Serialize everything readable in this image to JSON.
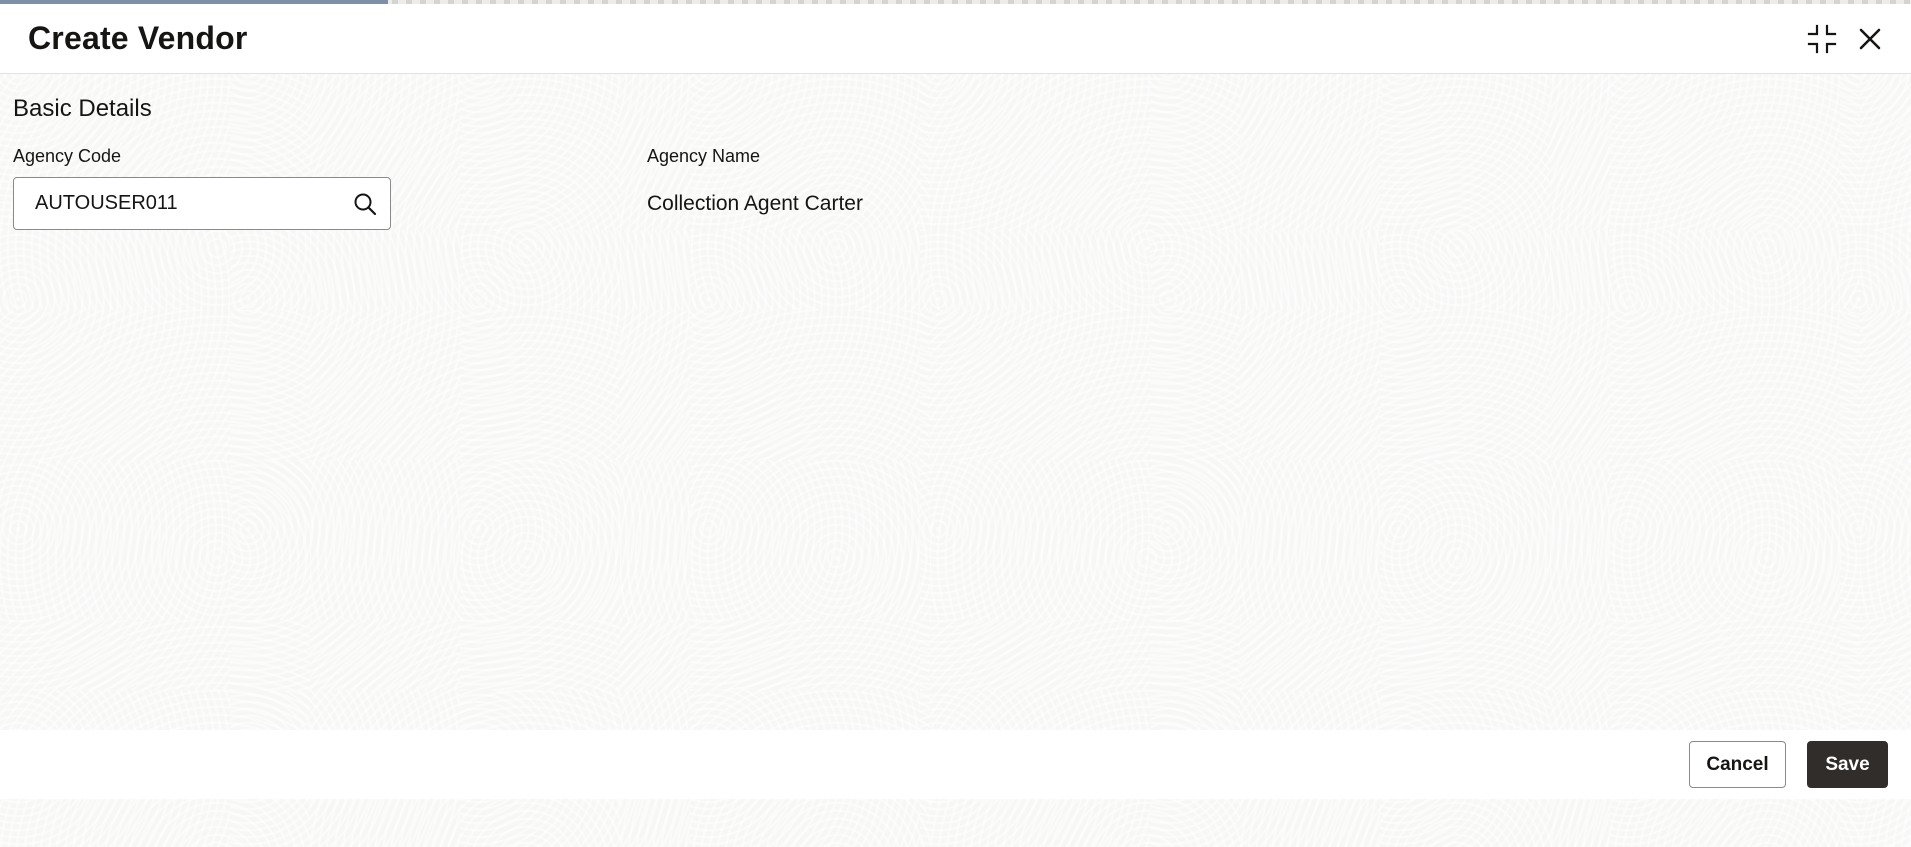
{
  "dialog": {
    "title": "Create Vendor"
  },
  "header_icons": {
    "collapse": "collapse-icon",
    "close": "close-icon"
  },
  "basic_details": {
    "section_title": "Basic Details",
    "agency_code": {
      "label": "Agency Code",
      "value": "AUTOUSER011",
      "icon": "search-icon"
    },
    "agency_name": {
      "label": "Agency Name",
      "value": "Collection Agent Carter"
    }
  },
  "footer": {
    "cancel_label": "Cancel",
    "save_label": "Save"
  },
  "colors": {
    "primary_button": "#312d2a",
    "text": "#161513",
    "border": "#8c8a86",
    "background": "#f7f7f6"
  }
}
